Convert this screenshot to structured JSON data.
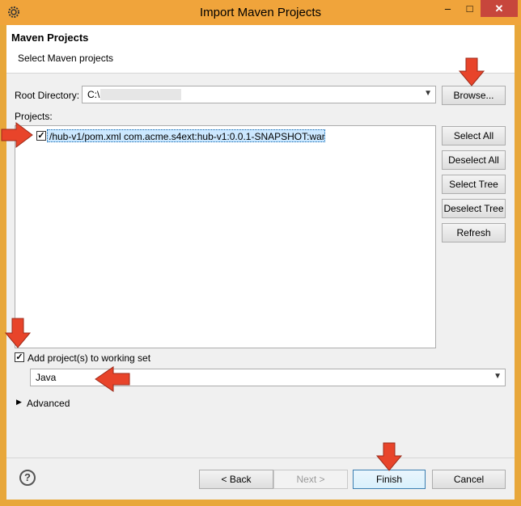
{
  "window": {
    "title": "Import Maven Projects",
    "minimize": "–",
    "maximize": "□",
    "close": "✕"
  },
  "header": {
    "title": "Maven Projects",
    "subtitle": "Select Maven projects"
  },
  "root": {
    "label": "Root Directory:",
    "value": "C:\\",
    "browse": "Browse..."
  },
  "projects": {
    "label": "Projects:",
    "items": [
      {
        "text": "/hub-v1/pom.xml  com.acme.s4ext:hub-v1:0.0.1-SNAPSHOT:war",
        "checked": true
      }
    ],
    "buttons": {
      "select_all": "Select All",
      "deselect_all": "Deselect All",
      "select_tree": "Select Tree",
      "deselect_tree": "Deselect Tree",
      "refresh": "Refresh"
    }
  },
  "working_set": {
    "label": "Add project(s) to working set",
    "checked": true,
    "value": "Java"
  },
  "advanced": {
    "label": "Advanced"
  },
  "footer": {
    "help": "?",
    "back": "< Back",
    "next": "Next >",
    "finish": "Finish",
    "cancel": "Cancel"
  },
  "colors": {
    "titlebar": "#f0a43b",
    "close_button": "#c7463c",
    "annotation_arrow": "#e8442a",
    "selection": "#cce8ff"
  }
}
